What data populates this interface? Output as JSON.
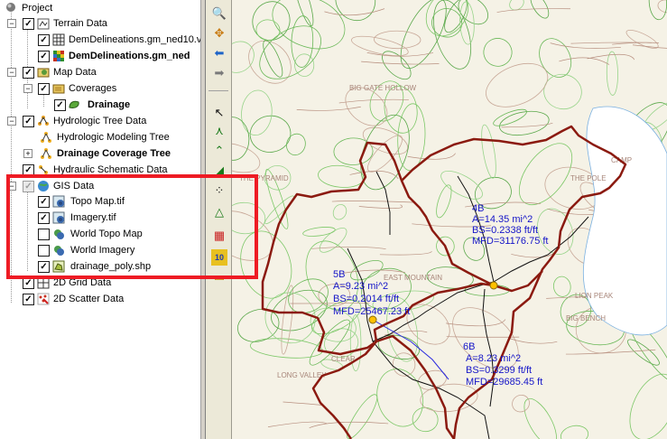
{
  "tree": {
    "items": [
      {
        "label": "Project",
        "bold": false,
        "icon": "project-icon"
      },
      {
        "label": "Terrain Data",
        "bold": false,
        "icon": "terrain-folder-icon"
      },
      {
        "label": "DemDelineations.gm_ned10.v",
        "bold": false,
        "icon": "dem-grid-icon"
      },
      {
        "label": "DemDelineations.gm_ned",
        "bold": true,
        "icon": "dem-grid-color-icon"
      },
      {
        "label": "Map Data",
        "bold": false,
        "icon": "map-folder-icon"
      },
      {
        "label": "Coverages",
        "bold": false,
        "icon": "coverages-folder-icon"
      },
      {
        "label": "Drainage",
        "bold": true,
        "icon": "drainage-coverage-icon"
      },
      {
        "label": "Hydrologic Tree Data",
        "bold": false,
        "icon": "hydrologic-tree-icon"
      },
      {
        "label": "Hydrologic Modeling Tree",
        "bold": false,
        "icon": "tree-node-icon"
      },
      {
        "label": "Drainage Coverage Tree",
        "bold": true,
        "icon": "tree-node-icon"
      },
      {
        "label": "Hydraulic Schematic Data",
        "bold": false,
        "icon": "hydraulic-schematic-icon"
      },
      {
        "label": "GIS Data",
        "bold": false,
        "icon": "gis-globe-icon"
      },
      {
        "label": "Topo Map.tif",
        "bold": false,
        "icon": "raster-icon"
      },
      {
        "label": "Imagery.tif",
        "bold": false,
        "icon": "raster-icon"
      },
      {
        "label": "World Topo Map",
        "bold": false,
        "icon": "globe-layer-icon"
      },
      {
        "label": "World Imagery",
        "bold": false,
        "icon": "globe-layer-icon"
      },
      {
        "label": "drainage_poly.shp",
        "bold": false,
        "icon": "shapefile-icon"
      },
      {
        "label": "2D Grid Data",
        "bold": false,
        "icon": "grid-2d-icon"
      },
      {
        "label": "2D Scatter Data",
        "bold": false,
        "icon": "scatter-2d-icon"
      }
    ]
  },
  "toolbar": {
    "tools": [
      "zoom-icon",
      "pan-icon",
      "back-arrow-icon",
      "forward-arrow-icon",
      "select-arrow-icon",
      "select-vertex-icon",
      "select-arc-icon",
      "select-polygon-icon",
      "create-point-icon",
      "create-polygon-icon",
      "color-grid-icon",
      "number-10-icon",
      "folder-icon"
    ],
    "number_label": "10"
  },
  "map": {
    "basemap_labels": [
      "BIG GATE HOLLOW",
      "THE PYRAMID",
      "EAST MOUNTAIN",
      "LONG VALLEY",
      "THE POLE",
      "BIG BENCH",
      "CLEAR",
      "CAMP",
      "LION PEAK"
    ],
    "basins": [
      {
        "id": "4B",
        "area": "A=14.35 mi^2",
        "slope": "BS=0.2338 ft/ft",
        "mfd": "MFD=31176.75 ft"
      },
      {
        "id": "5B",
        "area": "A=9.23 mi^2",
        "slope": "BS=0.2014 ft/ft",
        "mfd": "MFD=25467.23 ft"
      },
      {
        "id": "6B",
        "area": "A=8.23 mi^2",
        "slope": "BS=0.3299 ft/ft",
        "mfd": "MFD=29685.45 ft"
      }
    ]
  },
  "colors": {
    "highlight": "#ee1b24",
    "basin_boundary": "#8b1a10",
    "label_text": "#1515c8",
    "outlet": "#ffc000",
    "contour": "#6fc05a"
  }
}
